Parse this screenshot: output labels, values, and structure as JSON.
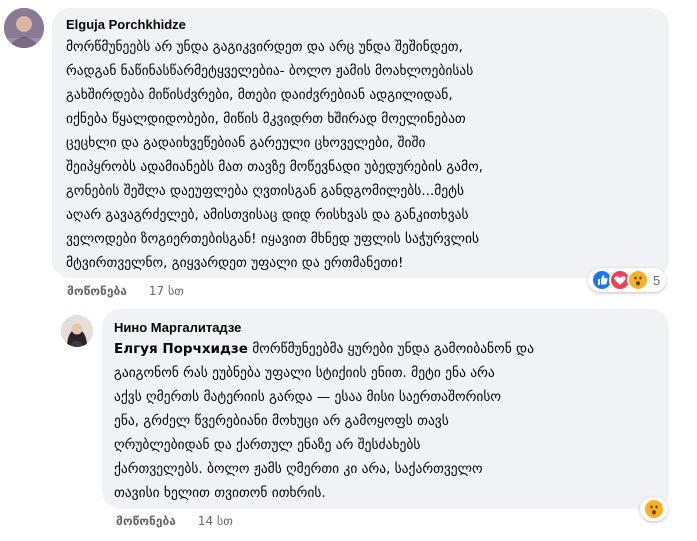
{
  "comments": [
    {
      "author": "Elguja Porchkhidze",
      "lines": [
        "მორწმუნეებს არ უნდა გაგიკვირდეთ და არც უნდა შეშინდეთ,",
        "რადგან ნაწინასწარმეტყველებია- ბოლო ჟამის მოახლოებისას",
        "გახშირდება მიწისძვრები, მთები დაიძვრებიან ადგილიდან,",
        "იქნება წყალდიდობები, მიწის მკვიდრთ ხშირად მოელინებათ",
        "ცეცხლი და გადაიხვეწებიან გარეული ცხოველები, შიში",
        "შეიპყრობს ადამიანებს მათ თავზე მოწევნადი უბედურების გამო,",
        "გონების შეშლა დაეუფლება ღვთისგან განდგომილებს...მეტს",
        "აღარ გავაგრძელებ, ამისთვისაც დიდ რისხვას და განკითხვას",
        "ველოდები ზოგიერთებისგან! იყავით მხნედ უფლის საჭურვლის",
        "მტვირთველნო, გიყვარდეთ უფალი და ერთმანეთი!"
      ],
      "like_label": "მოწონება",
      "time": "17 სთ",
      "reaction_count": "5"
    },
    {
      "author": "Нино Маргалитадзе",
      "mention": "Елгуя Порчхидзе",
      "first_line_rest": " მორწმუნეებმა ყურები უნდა გამოიბანონ და",
      "lines": [
        "გაიგონონ რას ეუბნება უფალი სტიქიის ენით. მეტი ენა არა",
        "აქვს ღმერთს მატერიის გარდა — ესაა მისი საერთაშორისო",
        "ენა, გრძელ წვერებიანი მოხუცი არ გამოყოფს თავს",
        "ღრუბლებიდან და ქართულ ენაზე არ შესძახებს",
        "ქართველებს. ბოლო ჟამს ღმერთი კი არა, საქართველო",
        "თავისი ხელით თვითონ ითხრის."
      ],
      "like_label": "მოწონება",
      "time": "14 სთ"
    }
  ],
  "icons": {
    "like": "like-reaction-icon",
    "love": "love-reaction-icon",
    "wow": "wow-reaction-icon"
  },
  "colors": {
    "bubble": "#f0f2f5",
    "like_blue": "#1877f2",
    "love_red": "#f33e58",
    "wow_yellow": "#f7b125"
  }
}
